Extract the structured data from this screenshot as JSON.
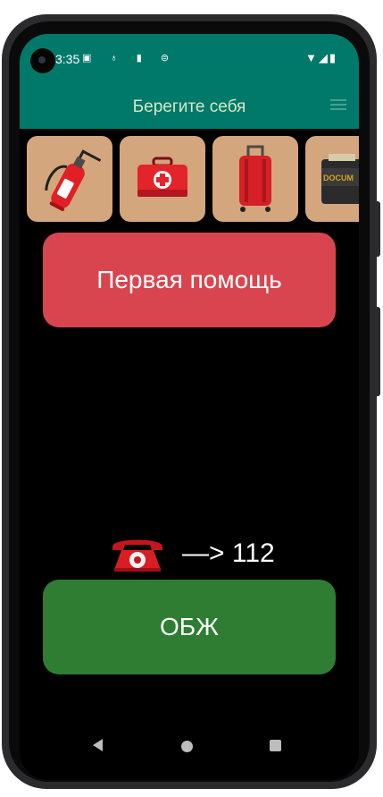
{
  "status_bar": {
    "time": "3:35",
    "left_icons": "▣ ♁ ▮ ⊜",
    "right_icons": "▼◢▮"
  },
  "app_bar": {
    "title": "Берегите себя",
    "menu_icon": "menu-icon"
  },
  "cards": [
    {
      "name": "fire-extinguisher",
      "icon": "fire-extinguisher-icon"
    },
    {
      "name": "first-aid-kit",
      "icon": "first-aid-kit-icon"
    },
    {
      "name": "suitcase",
      "icon": "suitcase-icon"
    },
    {
      "name": "documents",
      "icon": "documents-icon",
      "text": "DOCUM"
    }
  ],
  "main": {
    "first_aid_button": "Первая помощь",
    "emergency_text": "—> 112",
    "obzh_button": "ОБЖ"
  },
  "colors": {
    "app_bar": "#00796b",
    "card_bg": "#d3a67d",
    "first_aid_button": "#d9454e",
    "obzh_button": "#2e7d32"
  }
}
